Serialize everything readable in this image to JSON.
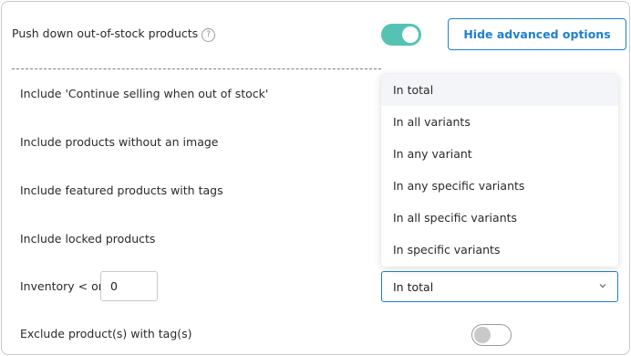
{
  "push_down": {
    "label": "Push down out-of-stock products",
    "help_icon": "question-circle-icon",
    "help_glyph": "?",
    "toggle_on": true,
    "advanced_button": "Hide advanced options"
  },
  "options": {
    "continue_selling": "Include 'Continue selling when out of stock'",
    "without_image": "Include products without an image",
    "featured_tags": "Include featured products with tags",
    "locked": "Include locked products"
  },
  "inventory": {
    "label": "Inventory < or=",
    "value": "0",
    "select_value": "In total",
    "chevron_icon": "chevron-down-icon"
  },
  "exclude": {
    "label": "Exclude product(s) with tag(s)",
    "toggle_on": false
  },
  "dropdown": {
    "options": [
      "In total",
      "In all variants",
      "In any variant",
      "In any specific variants",
      "In all specific variants",
      "In specific variants"
    ],
    "highlighted_index": 0
  },
  "colors": {
    "accent": "#1d7fd0",
    "toggle_on": "#55c3b4"
  }
}
